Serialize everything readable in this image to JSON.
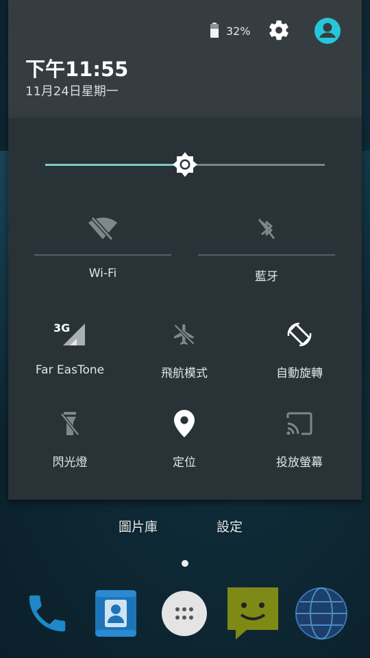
{
  "home": {
    "labels": {
      "gallery": "圖片庫",
      "settings": "設定"
    },
    "dock": [
      "phone-icon",
      "contacts-icon",
      "app-drawer-icon",
      "messaging-icon",
      "browser-icon"
    ]
  },
  "header": {
    "battery_percent": "32%",
    "time": "下午11:55",
    "date": "11月24日星期一"
  },
  "brightness": {
    "level": 0.5
  },
  "tiles": {
    "wifi": {
      "label": "Wi-Fi",
      "state": "off"
    },
    "bluetooth": {
      "label": "藍牙",
      "state": "off"
    },
    "cellular": {
      "label": "Far EasTone",
      "network": "3G"
    },
    "airplane": {
      "label": "飛航模式",
      "state": "off"
    },
    "rotate": {
      "label": "自動旋轉",
      "state": "on"
    },
    "flashlight": {
      "label": "閃光燈",
      "state": "off"
    },
    "location": {
      "label": "定位",
      "state": "on"
    },
    "cast": {
      "label": "投放螢幕",
      "state": "off"
    }
  },
  "colors": {
    "accent": "#80cbc4",
    "profile": "#26c6da",
    "header_bg": "#363d41",
    "panel_bg": "#293236"
  }
}
